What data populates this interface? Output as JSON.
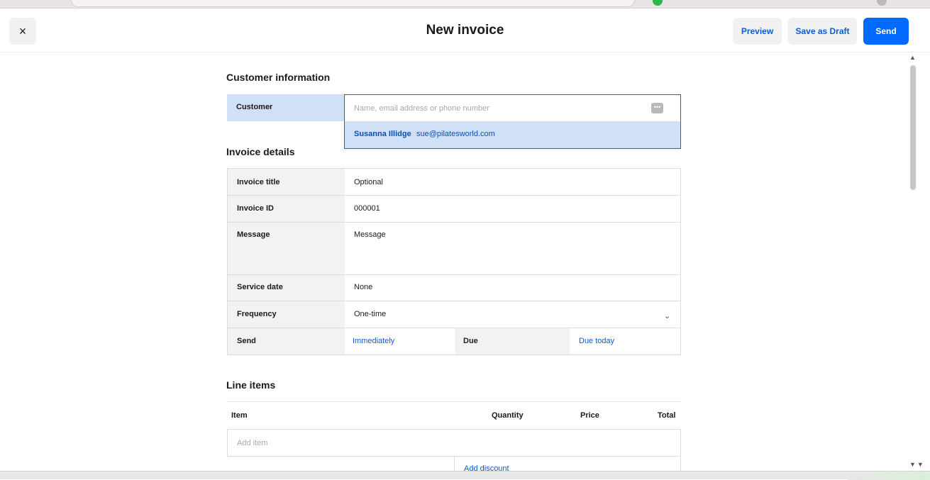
{
  "header": {
    "close_symbol": "×",
    "title": "New invoice",
    "preview_label": "Preview",
    "draft_label": "Save as Draft",
    "send_label": "Send"
  },
  "customer_section": {
    "title": "Customer information",
    "label": "Customer",
    "placeholder": "Name, email address or phone number",
    "suggestion": {
      "name": "Susanna Illidge",
      "email": "sue@pilatesworld.com"
    }
  },
  "details_section": {
    "title": "Invoice details",
    "invoice_title_label": "Invoice title",
    "invoice_title_placeholder": "Optional",
    "invoice_id_label": "Invoice ID",
    "invoice_id_value": "000001",
    "message_label": "Message",
    "message_placeholder": "Message",
    "service_date_label": "Service date",
    "service_date_value": "None",
    "frequency_label": "Frequency",
    "frequency_value": "One-time",
    "send_label": "Send",
    "send_value": "Immediately",
    "due_label": "Due",
    "due_value": "Due today"
  },
  "line_items": {
    "title": "Line items",
    "columns": {
      "item": "Item",
      "quantity": "Quantity",
      "price": "Price",
      "total": "Total"
    },
    "add_item_placeholder": "Add item",
    "add_discount": "Add discount"
  },
  "colors": {
    "accent": "#006aff",
    "link": "#0b5bd3",
    "highlight": "#cfe0f7"
  }
}
